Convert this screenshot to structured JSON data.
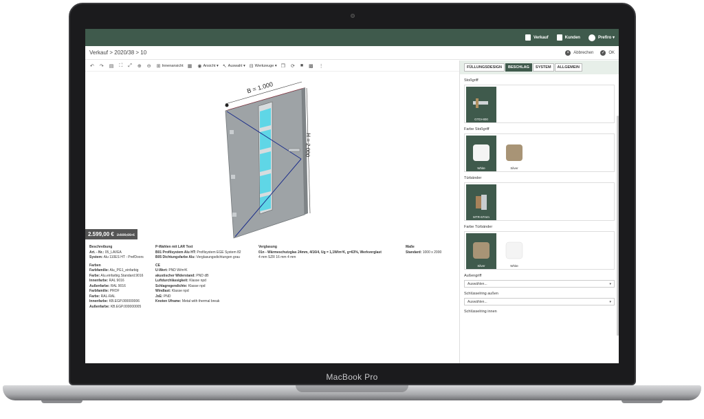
{
  "device": {
    "brand": "MacBook Pro"
  },
  "topbar": {
    "verkauf": "Verkauf",
    "kunden": "Kunden",
    "user": "Prefiro"
  },
  "subbar": {
    "breadcrumb": "Verkauf > 2020/38 > 10",
    "cancel": "Abbrechen",
    "ok": "OK"
  },
  "toolbar": {
    "innenansicht": "Innenansicht",
    "ansicht": "Ansicht",
    "auswahl": "Auswahl",
    "werkzeuge": "Werkzeuge"
  },
  "viewer": {
    "width_label": "B = 1.000",
    "height_label": "H = 2.000"
  },
  "price": {
    "current": "2.599,00 €",
    "old": "2.599,00 €"
  },
  "details": {
    "beschreibung": {
      "title": "Beschreibung",
      "art_label": "Art. - Nr.:",
      "art_value": "05_LAVEA",
      "system_label": "System:",
      "system_value": "Alu 110ES HT - PrefDoors"
    },
    "pwahlen": {
      "title": "P-Wahlen mit LAR Text",
      "l1_label": "B01 Profilsystem Alu HT:",
      "l1_value": "Profilsystem EGE System 82",
      "l2_label": "B05 Dichtungsfarbe Alu:",
      "l2_value": "Verglasungsdichtungen grau"
    },
    "verglasung": {
      "title": "Verglasung",
      "l1_label": "01n - Wärmeschutzglas 24mm, 4/16/4, Ug = 1,1W/m²K, g=63%, Werkverglast",
      "l2": "4 mm SZR 16 mm 4 mm"
    },
    "masse": {
      "title": "Maße",
      "label": "Standard:",
      "value": "1000 x 2000"
    },
    "farben": {
      "title": "Farben",
      "rows": [
        {
          "k": "Farbfamilie:",
          "v": "Alu_PG1_einfarbig"
        },
        {
          "k": "Farbe:",
          "v": "Alu.einfarbig.Standard.9016"
        },
        {
          "k": "Innenfarbe:",
          "v": "RAL 9016"
        },
        {
          "k": "Außenfarbe:",
          "v": "RAL 9016"
        },
        {
          "k": "Farbfamilie:",
          "v": "PROF"
        },
        {
          "k": "Farbe:",
          "v": "RAL-RAL"
        },
        {
          "k": "Innenfarbe:",
          "v": "KB.EGP.000000006"
        },
        {
          "k": "Außenfarbe:",
          "v": "KB.EGP.000000005"
        }
      ]
    },
    "ce": {
      "title": "CE",
      "rows": [
        {
          "k": "U-Wert:",
          "v": "PND W/m²K"
        },
        {
          "k": "akustischer Widerstand:",
          "v": "PND dB"
        },
        {
          "k": "Luftdurchlässigkeit:",
          "v": "Klasse npd"
        },
        {
          "k": "Schlagregendichte:",
          "v": "Klasse npd"
        },
        {
          "k": "Windlast:",
          "v": "Klasse npd"
        },
        {
          "k": "JxE:",
          "v": "PND"
        },
        {
          "k": "Knoten Uframe:",
          "v": "Metal with thermal break"
        }
      ]
    }
  },
  "panel": {
    "tabs": [
      "FÜLLUNGSDESIGN",
      "BESCHLAG",
      "SYSTEM",
      "ALLGEMEIN"
    ],
    "stossgriff": {
      "title": "Stoßgriff",
      "item": "GTDI-800"
    },
    "farbe_stossgriff": {
      "title": "Farbe Stoßgriff",
      "items": [
        "White",
        "Silver"
      ]
    },
    "turbander": {
      "title": "Türbänder",
      "item": "MTR-67mm"
    },
    "farbe_turbander": {
      "title": "Farbe Türbänder",
      "items": [
        "Silver",
        "White"
      ]
    },
    "aussengriff": {
      "title": "Außengriff",
      "placeholder": "Auswählen..."
    },
    "schluesselring_aussen": {
      "title": "Schlüsselring außen",
      "placeholder": "Auswählen..."
    },
    "schluesselring_innen": {
      "title": "Schlüsselring innen"
    }
  },
  "colors": {
    "accent": "#3f5a4c",
    "glass": "#5fd6e6",
    "door": "#9ea3a6"
  }
}
